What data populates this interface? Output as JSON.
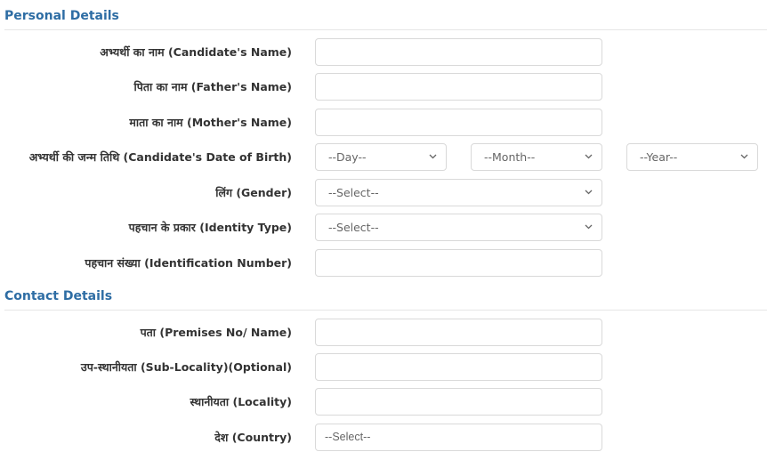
{
  "personal": {
    "title": "Personal Details",
    "candidate_name": {
      "label": "अभ्यर्थी का नाम (Candidate's Name)",
      "value": ""
    },
    "father_name": {
      "label": "पिता का नाम (Father's Name)",
      "value": ""
    },
    "mother_name": {
      "label": "माता का नाम (Mother's Name)",
      "value": ""
    },
    "dob": {
      "label": "अभ्यर्थी की जन्म तिथि (Candidate's Date of Birth)",
      "day": "--Day--",
      "month": "--Month--",
      "year": "--Year--"
    },
    "gender": {
      "label": "लिंग (Gender)",
      "selected": "--Select--"
    },
    "identity_type": {
      "label": "पहचान के प्रकार (Identity Type)",
      "selected": "--Select--"
    },
    "identification_number": {
      "label": "पहचान संख्या (Identification Number)",
      "value": ""
    }
  },
  "contact": {
    "title": "Contact Details",
    "premises": {
      "label": "पता (Premises No/ Name)",
      "value": ""
    },
    "sub_locality": {
      "label": "उप-स्थानीयता (Sub-Locality)(Optional)",
      "value": ""
    },
    "locality": {
      "label": "स्थानीयता (Locality)",
      "value": ""
    },
    "country": {
      "label": "देश (Country)",
      "selected": "--Select--"
    }
  },
  "icons": {
    "dropdown": "chevron-down-icon"
  }
}
